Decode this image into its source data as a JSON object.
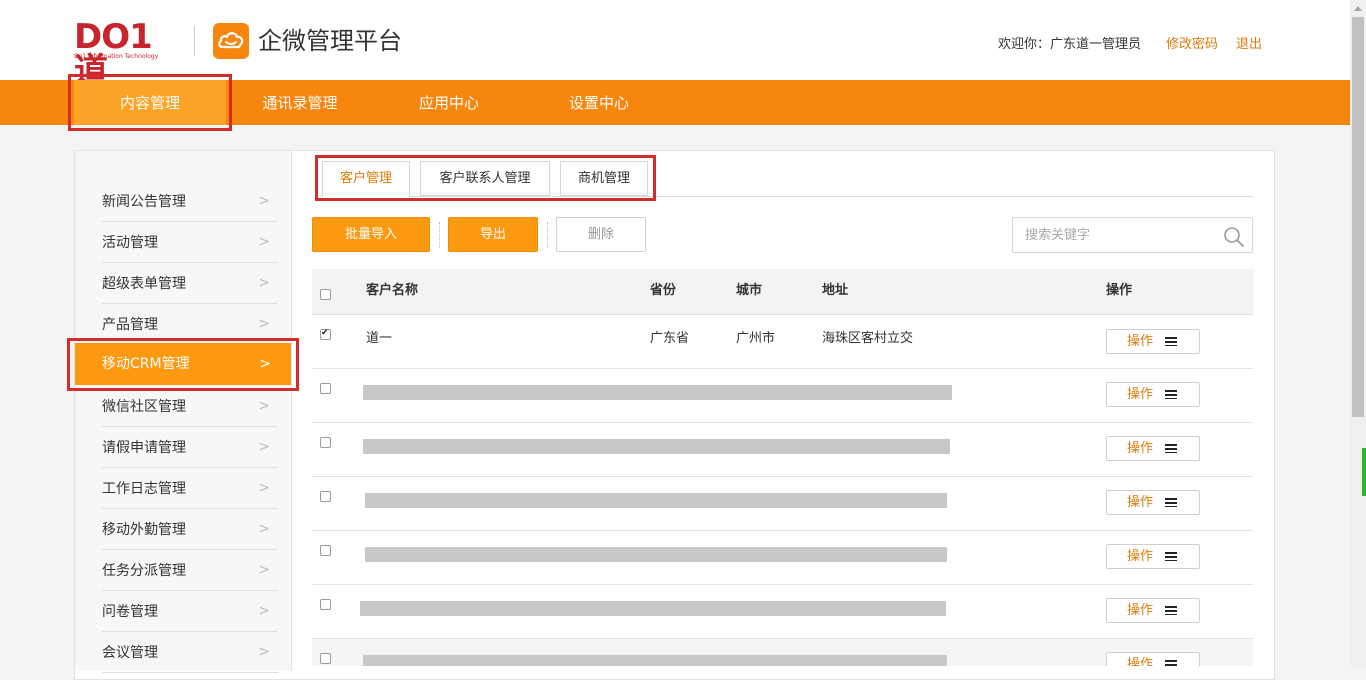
{
  "header": {
    "logo_text": "DO1道",
    "logo_sub": "Do1 Information Technology",
    "app_name": "企微管理平台",
    "welcome": "欢迎你：广东道一管理员",
    "change_password": "修改密码",
    "logout": "退出"
  },
  "nav": {
    "items": [
      {
        "label": "内容管理",
        "active": true
      },
      {
        "label": "通讯录管理"
      },
      {
        "label": "应用中心"
      },
      {
        "label": "设置中心"
      }
    ]
  },
  "sidebar": {
    "items": [
      {
        "label": "新闻公告管理"
      },
      {
        "label": "活动管理"
      },
      {
        "label": "超级表单管理"
      },
      {
        "label": "产品管理"
      },
      {
        "label": "移动CRM管理",
        "active": true
      },
      {
        "label": "微信社区管理"
      },
      {
        "label": "请假申请管理"
      },
      {
        "label": "工作日志管理"
      },
      {
        "label": "移动外勤管理"
      },
      {
        "label": "任务分派管理"
      },
      {
        "label": "问卷管理"
      },
      {
        "label": "会议管理"
      }
    ],
    "chevron": ">"
  },
  "tabs": [
    {
      "label": "客户管理",
      "active": true
    },
    {
      "label": "客户联系人管理"
    },
    {
      "label": "商机管理"
    }
  ],
  "toolbar": {
    "import_label": "批量导入",
    "export_label": "导出",
    "delete_label": "删除",
    "search_placeholder": "搜索关键字"
  },
  "table": {
    "columns": [
      "客户名称",
      "省份",
      "城市",
      "地址",
      "操作"
    ],
    "rows": [
      {
        "checked": true,
        "name": "道一",
        "province": "广东省",
        "city": "广州市",
        "address": "海珠区客村立交",
        "action": "操作"
      },
      {
        "checked": false,
        "redacted": true,
        "action": "操作"
      },
      {
        "checked": false,
        "redacted": true,
        "action": "操作"
      },
      {
        "checked": false,
        "redacted": true,
        "action": "操作"
      },
      {
        "checked": false,
        "redacted": true,
        "action": "操作"
      },
      {
        "checked": false,
        "redacted": true,
        "action": "操作"
      },
      {
        "checked": false,
        "redacted": true,
        "action": "操作"
      }
    ]
  },
  "colors": {
    "accent": "#f7860f",
    "accent_light": "#fb9a10",
    "link": "#e07b0d",
    "annotation_red": "#d22d2d"
  }
}
